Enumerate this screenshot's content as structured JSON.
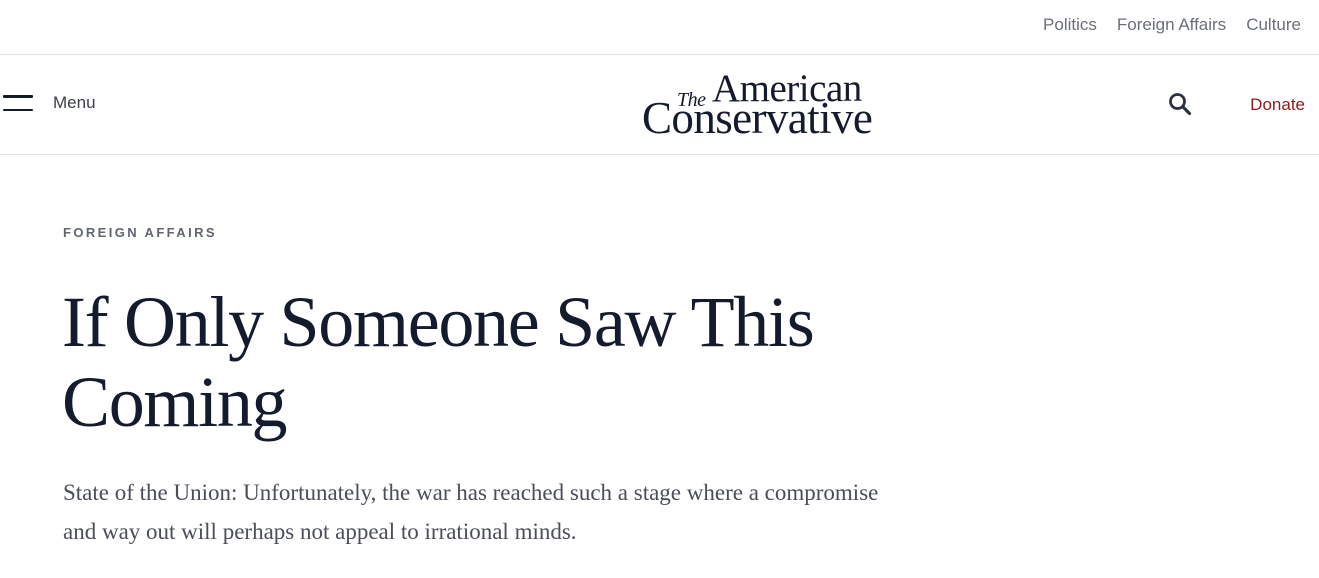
{
  "topbar": {
    "links": [
      "Politics",
      "Foreign Affairs",
      "Culture"
    ]
  },
  "header": {
    "menu_label": "Menu",
    "logo": {
      "the": "The",
      "american": "American",
      "conservative": "Conservative"
    },
    "search_icon": "search-icon",
    "donate_label": "Donate"
  },
  "article": {
    "category": "FOREIGN AFFAIRS",
    "headline": "If Only Someone Saw This Coming",
    "dek": "State of the Union: Unfortunately, the war has reached such a stage where a compromise and way out will perhaps not appeal to irrational minds."
  },
  "colors": {
    "text_primary": "#141b2d",
    "nav_text": "#6b6f78",
    "donate": "#8a1c1c",
    "category": "#5f6670",
    "divider": "#e3e3e3"
  }
}
